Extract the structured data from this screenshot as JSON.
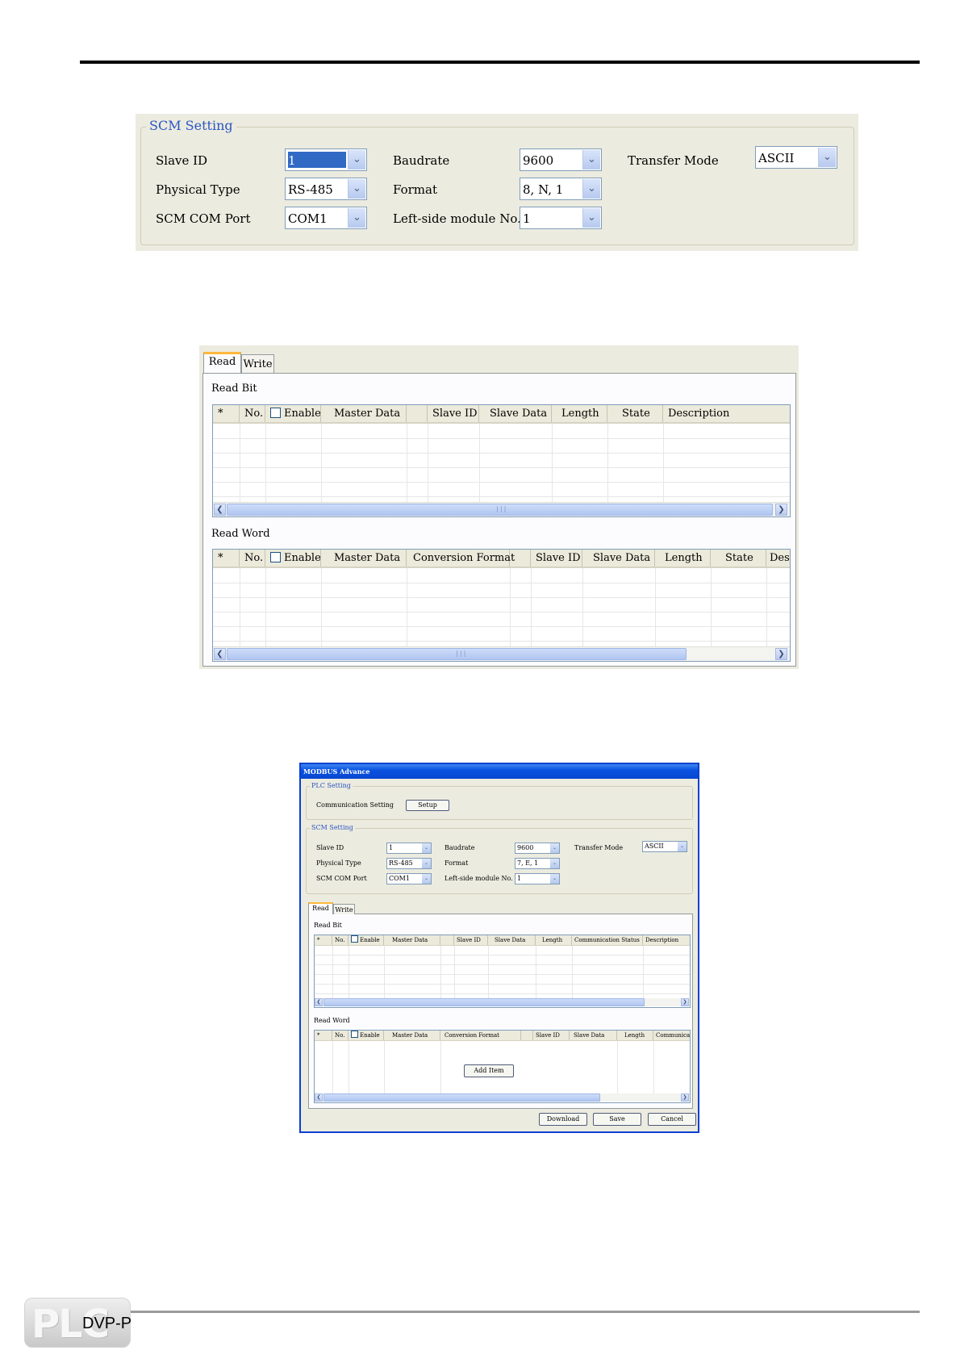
{
  "scm1": {
    "group_title": "SCM Setting",
    "slave_id_label": "Slave ID",
    "slave_id_value": "1",
    "physical_type_label": "Physical Type",
    "physical_type_value": "RS-485",
    "com_port_label": "SCM COM Port",
    "com_port_value": "COM1",
    "baudrate_label": "Baudrate",
    "baudrate_value": "9600",
    "format_label": "Format",
    "format_value": "8, N, 1",
    "left_module_label": "Left-side module No.",
    "left_module_value": "1",
    "transfer_mode_label": "Transfer Mode",
    "transfer_mode_value": "ASCII"
  },
  "rw": {
    "tab_read": "Read",
    "tab_write": "Write",
    "read_bit_label": "Read Bit",
    "read_word_label": "Read Word",
    "bit_columns": [
      "*",
      "No.",
      "Enable",
      "Master Data",
      "",
      "Slave ID",
      "Slave Data",
      "Length",
      "State",
      "Description"
    ],
    "word_columns": [
      "*",
      "No.",
      "Enable",
      "Master Data",
      "Conversion Format",
      "",
      "Slave ID",
      "Slave Data",
      "Length",
      "State",
      "Des"
    ]
  },
  "modbus": {
    "title": "MODBUS Advance",
    "plc_group": "PLC Setting",
    "comm_setting_label": "Communication Setting",
    "setup_button": "Setup",
    "scm_group": "SCM Setting",
    "slave_id_label": "Slave ID",
    "slave_id_value": "1",
    "physical_type_label": "Physical Type",
    "physical_type_value": "RS-485",
    "com_port_label": "SCM COM Port",
    "com_port_value": "COM1",
    "baudrate_label": "Baudrate",
    "baudrate_value": "9600",
    "format_label": "Format",
    "format_value": "7, E, 1",
    "left_module_label": "Left-side module No.",
    "left_module_value": "1",
    "transfer_mode_label": "Transfer Mode",
    "transfer_mode_value": "ASCII",
    "tab_read": "Read",
    "tab_write": "Write",
    "read_bit_label": "Read Bit",
    "read_word_label": "Read Word",
    "bit_columns": [
      "*",
      "No.",
      "Enable",
      "Master Data",
      "",
      "Slave ID",
      "Slave Data",
      "Length",
      "Communication Status",
      "Description"
    ],
    "word_columns": [
      "*",
      "No.",
      "Enable",
      "Master Data",
      "Conversion Format",
      "",
      "Slave ID",
      "Slave Data",
      "Length",
      "Communication"
    ],
    "add_item_button": "Add Item",
    "download_button": "Download",
    "save_button": "Save",
    "cancel_button": "Cancel"
  },
  "footer": {
    "logo_text": "PLC",
    "model": "DVP-P"
  }
}
